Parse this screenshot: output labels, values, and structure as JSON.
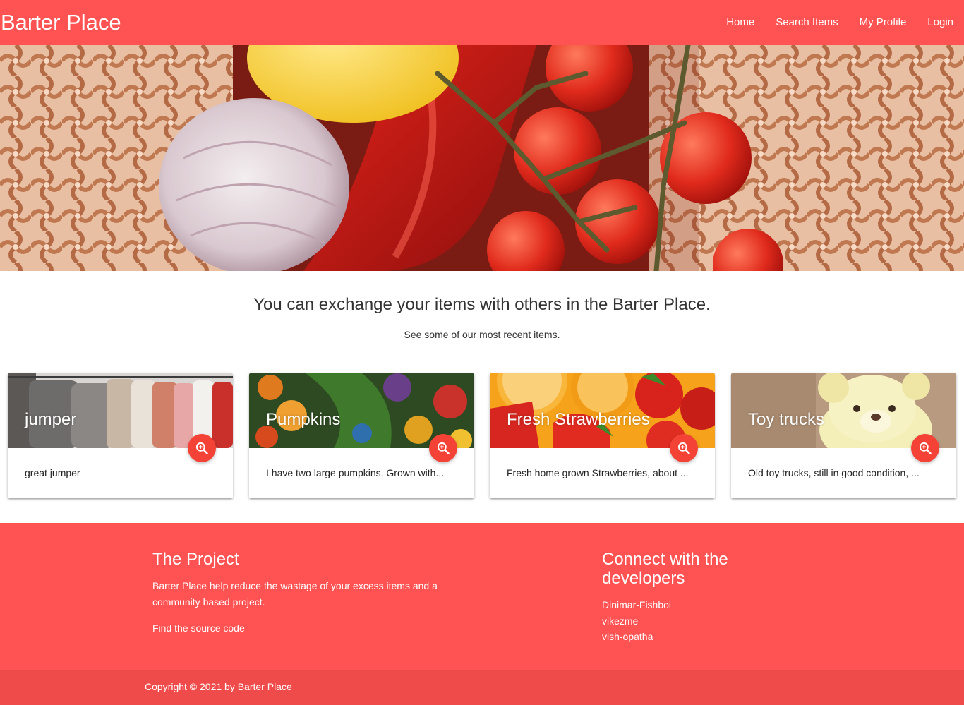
{
  "brand": "Barter Place",
  "nav": {
    "home": "Home",
    "search": "Search Items",
    "profile": "My Profile",
    "login": "Login"
  },
  "intro": {
    "title": "You can exchange your items with others in the Barter Place.",
    "subtitle": "See some of our most recent items."
  },
  "cards": [
    {
      "title": "jumper",
      "text": "great jumper",
      "fab_icon": "zoom-in-icon"
    },
    {
      "title": "Pumpkins",
      "text": "I have two large pumpkins. Grown with...",
      "fab_icon": "zoom-in-icon"
    },
    {
      "title": "Fresh Strawberries",
      "text": "Fresh home grown Strawberries, about ...",
      "fab_icon": "zoom-in-icon"
    },
    {
      "title": "Toy trucks",
      "text": "Old toy trucks, still in good condition, ...",
      "fab_icon": "zoom-in-icon"
    }
  ],
  "footer": {
    "project_title": "The Project",
    "project_text": "Barter Place help reduce the wastage of your excess items and a community based project.",
    "source_link": "Find the source code",
    "connect_title": "Connect with the developers",
    "developers": [
      "Dinimar-Fishboi",
      "vikezme",
      "vish-opatha"
    ],
    "copyright": "Copyright © 2021 by Barter Place"
  },
  "colors": {
    "primary": "#ff5252",
    "fab": "#f44336",
    "copyright_bar": "#ef4b4b"
  }
}
